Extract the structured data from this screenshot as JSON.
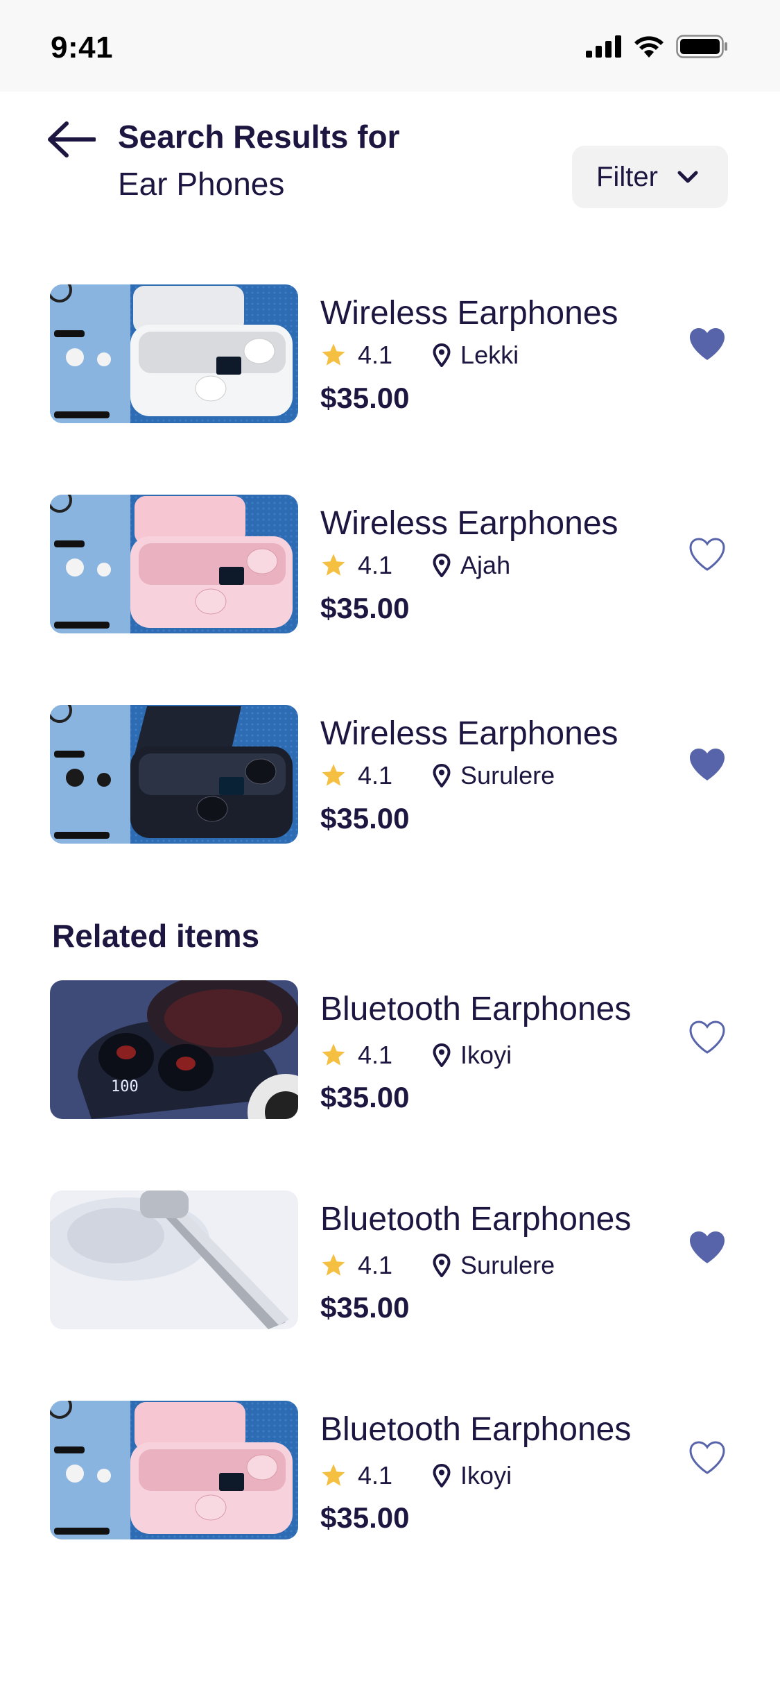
{
  "status_bar": {
    "time": "9:41"
  },
  "header": {
    "title": "Search Results for",
    "query": "Ear Phones",
    "filter_label": "Filter"
  },
  "colors": {
    "primary_text": "#1c1640",
    "accent_heart": "#5864a9",
    "star": "#f5bf42",
    "filter_bg": "#f2f2f2"
  },
  "results": [
    {
      "name": "Wireless Earphones",
      "rating": "4.1",
      "location": "Lekki",
      "price": "$35.00",
      "favorited": true,
      "image": "white-earbuds-case"
    },
    {
      "name": "Wireless Earphones",
      "rating": "4.1",
      "location": "Ajah",
      "price": "$35.00",
      "favorited": false,
      "image": "pink-earbuds-case"
    },
    {
      "name": "Wireless Earphones",
      "rating": "4.1",
      "location": "Surulere",
      "price": "$35.00",
      "favorited": true,
      "image": "black-earbuds-case"
    }
  ],
  "related_title": "Related items",
  "related": [
    {
      "name": "Bluetooth Earphones",
      "rating": "4.1",
      "location": "Ikoyi",
      "price": "$35.00",
      "favorited": false,
      "image": "dark-earbuds-case-photo"
    },
    {
      "name": "Bluetooth Earphones",
      "rating": "4.1",
      "location": "Surulere",
      "price": "$35.00",
      "favorited": true,
      "image": "single-bluetooth-headset"
    },
    {
      "name": "Bluetooth Earphones",
      "rating": "4.1",
      "location": "Ikoyi",
      "price": "$35.00",
      "favorited": false,
      "image": "pink-earbuds-case"
    }
  ]
}
